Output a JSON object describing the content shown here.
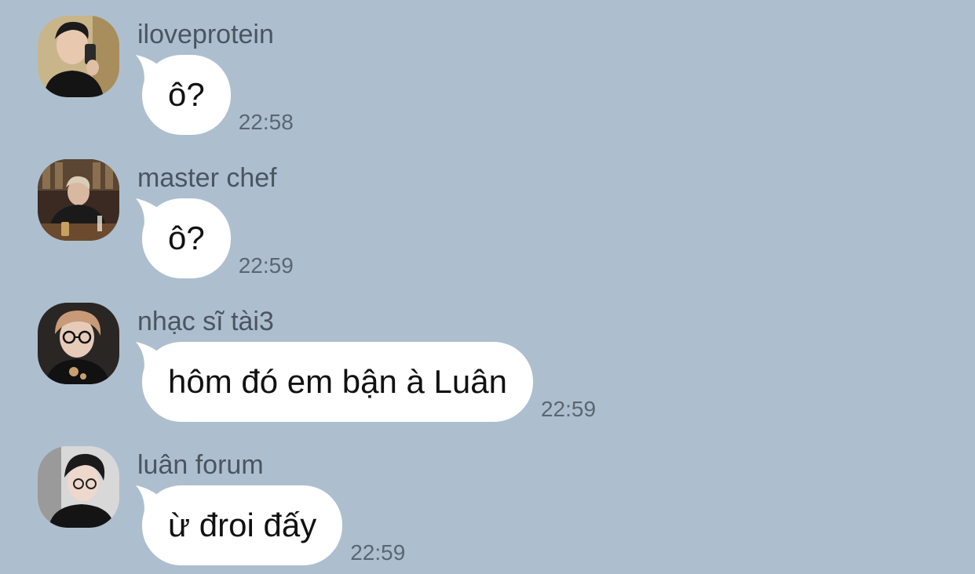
{
  "messages": [
    {
      "sender": "iloveprotein",
      "text": "ô?",
      "time": "22:58",
      "avatar": "avatar-iloveprotein"
    },
    {
      "sender": "master chef",
      "text": "ô?",
      "time": "22:59",
      "avatar": "avatar-master-chef"
    },
    {
      "sender": "nhạc sĩ tài3",
      "text": "hôm đó em bận à Luân",
      "time": "22:59",
      "avatar": "avatar-nhac-si-tai3"
    },
    {
      "sender": "luân forum",
      "text": "ừ đroi đấy",
      "time": "22:59",
      "avatar": "avatar-luan-forum"
    }
  ],
  "colors": {
    "background": "#adbfcf",
    "bubble": "#ffffff",
    "sender_text": "#4a5560",
    "time_text": "#5b6670"
  }
}
